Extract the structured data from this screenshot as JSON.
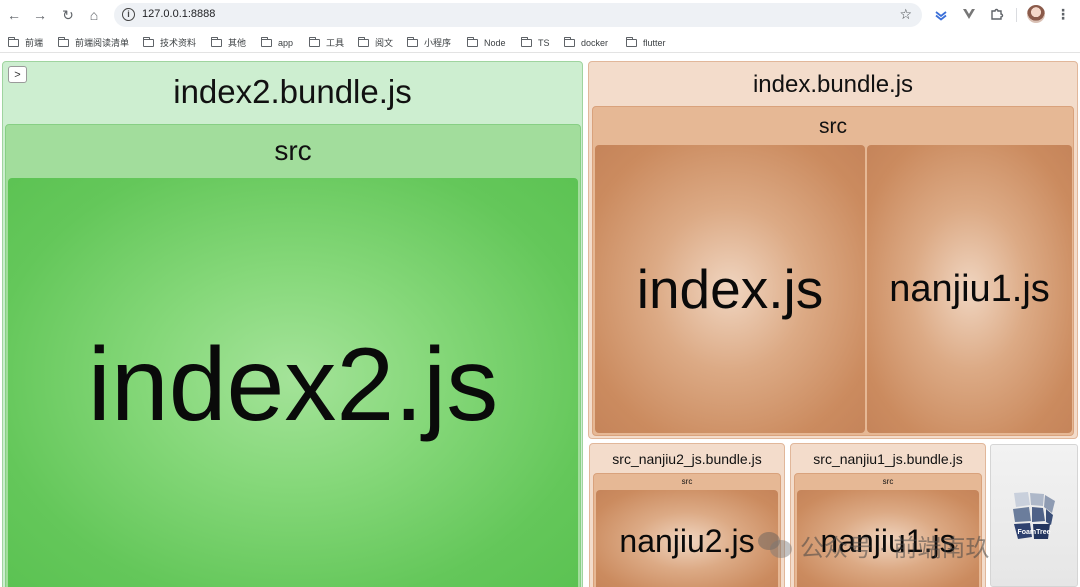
{
  "browser": {
    "nav_back_icon": "←",
    "nav_forward_icon": "→",
    "reload_icon": "↻",
    "home_icon": "⌂",
    "url": "127.0.0.1:8888",
    "star_icon": "☆",
    "menu_icon": "⋮"
  },
  "bookmarks": [
    {
      "label": "前端"
    },
    {
      "label": "前端阅读清单"
    },
    {
      "label": "技术资料"
    },
    {
      "label": "其他"
    },
    {
      "label": "app"
    },
    {
      "label": "工具"
    },
    {
      "label": "阅文"
    },
    {
      "label": "小程序"
    },
    {
      "label": "Node"
    },
    {
      "label": "TS"
    },
    {
      "label": "docker"
    },
    {
      "label": "flutter"
    }
  ],
  "treemap": {
    "expand_icon": ">",
    "bundles": {
      "index2": {
        "title": "index2.bundle.js",
        "folder": "src",
        "files": [
          "index2.js"
        ]
      },
      "index": {
        "title": "index.bundle.js",
        "folder": "src",
        "files": [
          "index.js",
          "nanjiu1.js"
        ]
      },
      "src_nanjiu2": {
        "title": "src_nanjiu2_js.bundle.js",
        "folder": "src",
        "files": [
          "nanjiu2.js"
        ]
      },
      "src_nanjiu1": {
        "title": "src_nanjiu1_js.bundle.js",
        "folder": "src",
        "files": [
          "nanjiu1.js"
        ]
      }
    },
    "foamtree_label": "FoamTree"
  },
  "watermark": {
    "text": "公众号 · 前端南玖"
  },
  "colors": {
    "green_leaf": "#64c75a",
    "tan_leaf": "#cb8b5f"
  }
}
